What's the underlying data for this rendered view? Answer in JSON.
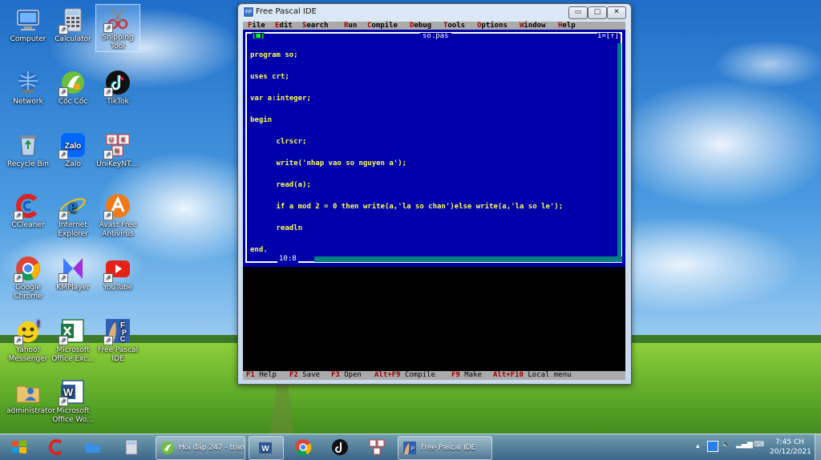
{
  "desktop": {
    "icons": [
      {
        "label": "Computer",
        "icon": "computer-icon"
      },
      {
        "label": "Calculator",
        "icon": "calculator-icon"
      },
      {
        "label": "Snipping Tool",
        "icon": "scissors-icon"
      },
      {
        "label": "Network",
        "icon": "network-icon"
      },
      {
        "label": "Cốc Cốc",
        "icon": "coccoc-icon"
      },
      {
        "label": "TikTok",
        "icon": "tiktok-icon"
      },
      {
        "label": "Recycle Bin",
        "icon": "recycle-bin-icon"
      },
      {
        "label": "Zalo",
        "icon": "zalo-icon"
      },
      {
        "label": "UniKeyNT....",
        "icon": "unikey-icon"
      },
      {
        "label": "CCleaner",
        "icon": "ccleaner-icon"
      },
      {
        "label": "Internet Explorer",
        "icon": "internet-explorer-icon"
      },
      {
        "label": "Avast Free Antivirus",
        "icon": "avast-icon"
      },
      {
        "label": "Google Chrome",
        "icon": "chrome-icon"
      },
      {
        "label": "KMPlayer",
        "icon": "kmplayer-icon"
      },
      {
        "label": "YouTube",
        "icon": "youtube-icon"
      },
      {
        "label": "Yahoo! Messenger",
        "icon": "yahoo-icon"
      },
      {
        "label": "Microsoft Office Exc...",
        "icon": "excel-icon"
      },
      {
        "label": "Free Pascal IDE",
        "icon": "free-pascal-icon"
      },
      {
        "label": "administrator",
        "icon": "user-folder-icon"
      },
      {
        "label": "Microsoft Office Wo...",
        "icon": "word-icon"
      }
    ]
  },
  "window": {
    "title": "Free Pascal IDE",
    "buttons": {
      "minimize": "▭",
      "maximize": "□",
      "close": "✕"
    }
  },
  "ide": {
    "menu": [
      {
        "hotkey": "F",
        "rest": "ile"
      },
      {
        "hotkey": "E",
        "rest": "dit"
      },
      {
        "hotkey": "S",
        "rest": "earch"
      },
      {
        "hotkey": "R",
        "rest": "un"
      },
      {
        "hotkey": "C",
        "rest": "ompile"
      },
      {
        "hotkey": "D",
        "rest": "ebug"
      },
      {
        "hotkey": "T",
        "rest": "ools"
      },
      {
        "hotkey": "O",
        "rest": "ptions"
      },
      {
        "hotkey": "W",
        "rest": "indow"
      },
      {
        "hotkey": "H",
        "rest": "elp"
      }
    ],
    "editor": {
      "filename": "so.pas",
      "close_box": "[■]",
      "window_number": "1=[↑]",
      "position": "10:8",
      "code": [
        "program so;",
        "uses crt;",
        "var a:integer;",
        "begin",
        "      clrscr;",
        "      write('nhap vao so nguyen a');",
        "      read(a);",
        "      if a mod 2 = 0 then write(a,'la so chan')else write(a,'la so le');",
        "      readln",
        "end."
      ]
    },
    "status": [
      {
        "key": "F1",
        "desc": "Help"
      },
      {
        "key": "F2",
        "desc": "Save"
      },
      {
        "key": "F3",
        "desc": "Open"
      },
      {
        "key": "Alt+F9",
        "desc": "Compile"
      },
      {
        "key": "F9",
        "desc": "Make"
      },
      {
        "key": "Alt+F10",
        "desc": "Local menu"
      }
    ]
  },
  "taskbar": {
    "tasks": [
      {
        "label": "Hỏi đáp 247 - tran...",
        "icon": "coccoc-icon"
      },
      {
        "label": "",
        "icon": "word-icon"
      },
      {
        "label": "",
        "icon": "chrome-icon"
      },
      {
        "label": "",
        "icon": "tiktok-icon"
      },
      {
        "label": "",
        "icon": "unikey-icon"
      },
      {
        "label": "Free Pascal IDE",
        "icon": "free-pascal-icon"
      }
    ],
    "clock_time": "7:45 CH",
    "clock_date": "20/12/2021"
  },
  "colors": {
    "editor_bg": "#0000aa",
    "code_text": "#ffff55",
    "menu_bg": "#aaaaaa",
    "hotkey": "#a00000"
  }
}
